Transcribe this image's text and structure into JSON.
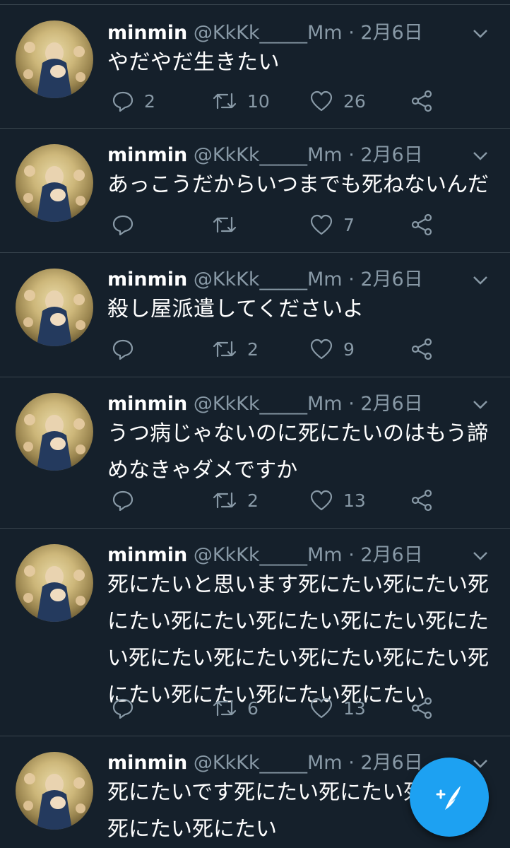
{
  "tweets": [
    {
      "name": "minmin",
      "handle": "@KkKk_____Mm",
      "date": "· 2月6日",
      "text": "やだやだ生きたい",
      "replies": "2",
      "retweets": "10",
      "likes": "26"
    },
    {
      "name": "minmin",
      "handle": "@KkKk_____Mm",
      "date": "· 2月6日",
      "text": "あっこうだからいつまでも死ねないんだ",
      "replies": "",
      "retweets": "",
      "likes": "7"
    },
    {
      "name": "minmin",
      "handle": "@KkKk_____Mm",
      "date": "· 2月6日",
      "text": "殺し屋派遣してくださいよ",
      "replies": "",
      "retweets": "2",
      "likes": "9"
    },
    {
      "name": "minmin",
      "handle": "@KkKk_____Mm",
      "date": "· 2月6日",
      "text": "うつ病じゃないのに死にたいのはもう諦めなきゃダメですか",
      "replies": "",
      "retweets": "2",
      "likes": "13"
    },
    {
      "name": "minmin",
      "handle": "@KkKk_____Mm",
      "date": "· 2月6日",
      "text": "死にたいと思います死にたい死にたい死にたい死にたい死にたい死にたい死にたい死にたい死にたい死にたい死にたい死にたい死にたい死にたい死にたい",
      "replies": "",
      "retweets": "6",
      "likes": "13"
    },
    {
      "name": "minmin",
      "handle": "@KkKk_____Mm",
      "date": "· 2月6日",
      "text": "死にたいです死にたい死にたい死にたい死にたい死にたい",
      "replies": "",
      "retweets": "",
      "likes": ""
    }
  ],
  "icons": {
    "reply": "reply-icon",
    "retweet": "retweet-icon",
    "like": "heart-icon",
    "share": "share-icon",
    "menu": "chevron-down-icon",
    "compose": "compose-tweet-icon"
  },
  "colors": {
    "background": "#15202b",
    "divider": "#38444d",
    "secondary_text": "#8899a6",
    "accent": "#1da1f2"
  }
}
